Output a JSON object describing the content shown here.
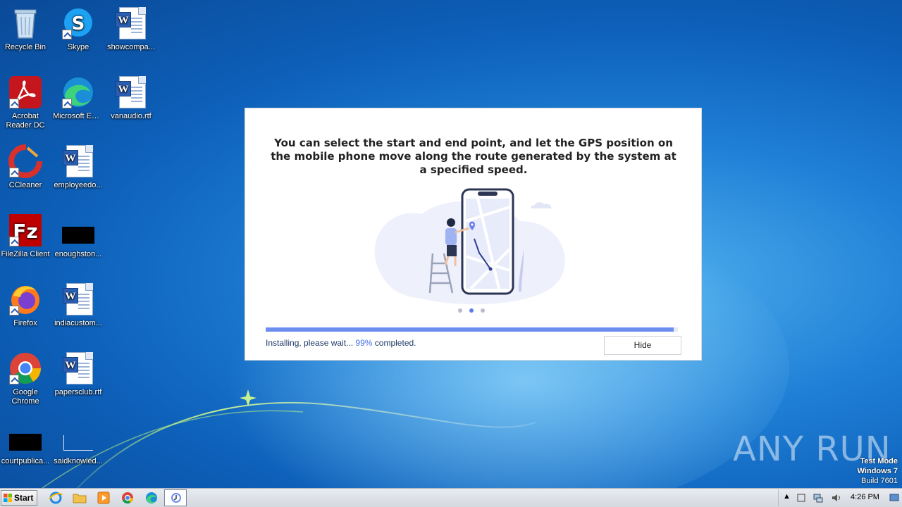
{
  "desktop": {
    "icons": [
      {
        "label": "Recycle Bin",
        "icon": "recycle-bin-icon"
      },
      {
        "label": "Skype",
        "icon": "skype-icon"
      },
      {
        "label": "showcompa...",
        "icon": "word-document-icon"
      },
      {
        "label": "Acrobat Reader DC",
        "icon": "acrobat-icon"
      },
      {
        "label": "Microsoft Edge",
        "icon": "edge-icon"
      },
      {
        "label": "vanaudio.rtf",
        "icon": "word-document-icon"
      },
      {
        "label": "CCleaner",
        "icon": "ccleaner-icon"
      },
      {
        "label": "employeedo...",
        "icon": "word-document-icon"
      },
      {
        "label": "FileZilla Client",
        "icon": "filezilla-icon"
      },
      {
        "label": "enoughston...",
        "icon": "black-file-icon"
      },
      {
        "label": "Firefox",
        "icon": "firefox-icon"
      },
      {
        "label": "indiacustom...",
        "icon": "word-document-icon"
      },
      {
        "label": "Google Chrome",
        "icon": "chrome-icon"
      },
      {
        "label": "papersclub.rtf",
        "icon": "word-document-icon"
      },
      {
        "label": "courtpublica...",
        "icon": "black-file-icon"
      },
      {
        "label": "saidknowled...",
        "icon": "blank-file-icon"
      }
    ]
  },
  "dialog": {
    "headline": "You can select the start and end point, and let the GPS position on the mobile phone move along the route generated by the system at a specified speed.",
    "status_prefix": "Installing, please wait...",
    "percent_text": "99%",
    "status_suffix": "completed.",
    "progress": 0.99,
    "carousel_active_index": 1,
    "carousel_count": 3,
    "hide_label": "Hide",
    "colors": {
      "accent": "#6b8ef0",
      "percent": "#4a73e8"
    }
  },
  "watermark": {
    "text": "ANY RUN"
  },
  "os_info": {
    "line1": "Test Mode",
    "line2": "Windows 7",
    "line3": "Build 7601"
  },
  "taskbar": {
    "start_label": "Start",
    "pinned": [
      "internet-explorer-icon",
      "explorer-folder-icon",
      "media-player-icon",
      "chrome-icon",
      "edge-icon",
      "installer-app-icon"
    ],
    "clock": "4:26 PM"
  }
}
